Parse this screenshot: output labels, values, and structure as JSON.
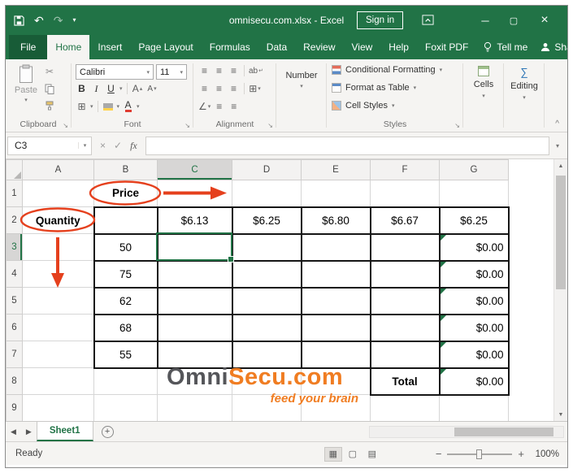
{
  "window": {
    "title": "omnisecu.com.xlsx - Excel",
    "sign_in_label": "Sign in"
  },
  "ribbon": {
    "tabs": [
      "File",
      "Home",
      "Insert",
      "Page Layout",
      "Formulas",
      "Data",
      "Review",
      "View",
      "Help",
      "Foxit PDF"
    ],
    "active_tab": "Home",
    "tell_me_label": "Tell me",
    "share_label": "Share",
    "clipboard": {
      "group_label": "Clipboard",
      "paste_label": "Paste"
    },
    "font": {
      "group_label": "Font",
      "font_name": "Calibri",
      "font_size": "11",
      "bold": "B",
      "italic": "I",
      "underline": "U"
    },
    "alignment": {
      "group_label": "Alignment"
    },
    "number": {
      "format_value": "Number"
    },
    "styles": {
      "group_label": "Styles",
      "conditional_formatting_label": "Conditional Formatting",
      "format_as_table_label": "Format as Table",
      "cell_styles_label": "Cell Styles"
    },
    "cells": {
      "label": "Cells"
    },
    "editing": {
      "label": "Editing"
    }
  },
  "formula_bar": {
    "name_box_value": "C3",
    "fx_label": "fx"
  },
  "sheet": {
    "column_headers": [
      "A",
      "B",
      "C",
      "D",
      "E",
      "F",
      "G"
    ],
    "row_headers": [
      "1",
      "2",
      "3",
      "4",
      "5",
      "6",
      "7",
      "8",
      "9"
    ],
    "selected_cell": "C3",
    "price_label": "Price",
    "quantity_label": "Quantity",
    "prices": [
      "$6.13",
      "$6.25",
      "$6.80",
      "$6.67",
      "$6.25"
    ],
    "quantities": [
      "50",
      "75",
      "62",
      "68",
      "55"
    ],
    "results": [
      "$0.00",
      "$0.00",
      "$0.00",
      "$0.00",
      "$0.00"
    ],
    "total_label": "Total",
    "total_value": "$0.00"
  },
  "watermark": {
    "brand_dark": "Omni",
    "brand_orange": "Secu.com",
    "tagline": "feed your brain"
  },
  "sheet_tabs": {
    "active_sheet": "Sheet1"
  },
  "status_bar": {
    "ready_label": "Ready",
    "zoom_value": "100%"
  },
  "colors": {
    "excel_green": "#217346",
    "annotation_red": "#e5401d",
    "brand_orange": "#f07d22",
    "brand_gray": "#55565a",
    "error_triangle_green": "#217346"
  },
  "icons": {
    "caret_down": "▾",
    "caret_up": "▴",
    "undo": "↶",
    "redo": "↷",
    "minimize": "─",
    "maximize": "▢",
    "close": "×",
    "cut": "✂",
    "borders": "⊞",
    "align_lines": "≡",
    "merge_center": "⊞",
    "orientation": "∠",
    "wrap_return": "↵",
    "letter_a": "A",
    "letter_ab": "ab",
    "cancel": "×",
    "enter": "✓",
    "dialog_launcher": "↘",
    "collapse_ribbon": "^",
    "scroll_up": "▲",
    "scroll_down": "▼",
    "nav_left": "◀",
    "nav_right": "▶",
    "new_sheet": "+",
    "view_normal": "▦",
    "view_layout": "▢",
    "view_break": "▤",
    "zoom_out": "−",
    "zoom_in": "+",
    "sum": "∑"
  }
}
